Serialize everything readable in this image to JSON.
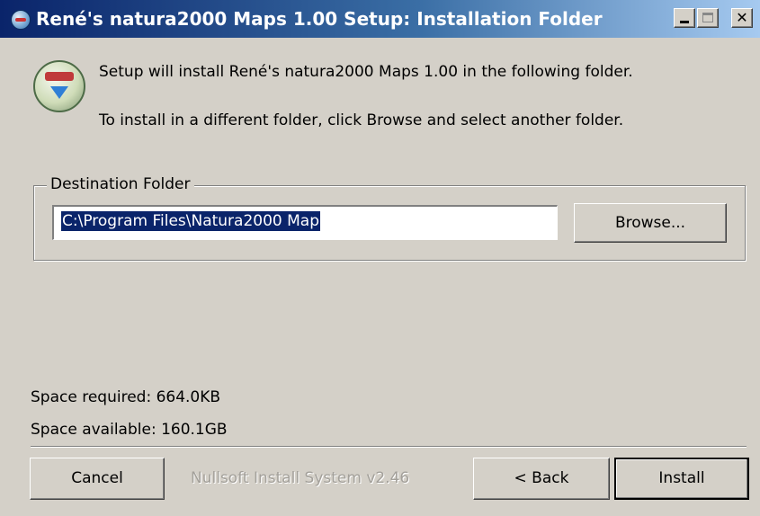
{
  "window": {
    "title": "René's natura2000 Maps 1.00 Setup: Installation Folder",
    "icon": "installer-globe-icon",
    "controls": {
      "minimize": "minimize-icon",
      "maximize": "maximize-icon",
      "close": "close-icon",
      "close_glyph": "✕"
    }
  },
  "intro": {
    "line1": "Setup will install René's natura2000 Maps 1.00 in the following folder.",
    "line2": "To install in a different folder, click Browse and select another folder.",
    "icon": "setup-disc-icon"
  },
  "destination": {
    "legend": "Destination Folder",
    "path": "C:\\Program Files\\Natura2000 Map",
    "browse_label": "Browse..."
  },
  "space": {
    "required": "Space required: 664.0KB",
    "available": "Space available: 160.1GB"
  },
  "footer": {
    "branding": "Nullsoft Install System v2.46",
    "cancel_label": "Cancel",
    "back_label": "< Back",
    "install_label": "Install"
  },
  "colors": {
    "face": "#d4d0c8",
    "title_start": "#0a246a",
    "title_end": "#a6caf0",
    "selection": "#0a246a"
  }
}
